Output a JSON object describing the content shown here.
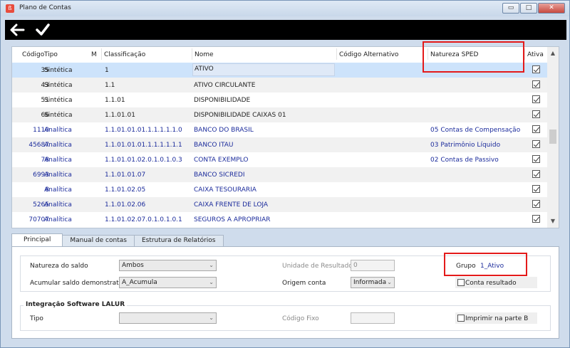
{
  "window": {
    "title": "Plano de Contas",
    "buttons": {
      "minimize": "▭",
      "maximize": "□",
      "close": "✕"
    }
  },
  "toolbar": {
    "back_icon": "arrow-left-icon",
    "confirm_icon": "check-icon"
  },
  "grid": {
    "columns": {
      "codigo": "Código",
      "tipo": "Tipo",
      "m": "M",
      "classificacao": "Classificação",
      "nome": "Nome",
      "codigo_alt": "Código Alternativo",
      "natureza_sped": "Natureza SPED",
      "ativa": "Ativa"
    },
    "rows": [
      {
        "codigo": "35",
        "tipo": "Sintética",
        "classificacao": "1",
        "nome": "ATIVO",
        "sped": "",
        "ativa": true,
        "analytic": false
      },
      {
        "codigo": "43",
        "tipo": "Sintética",
        "classificacao": "1.1",
        "nome": "ATIVO CIRCULANTE",
        "sped": "",
        "ativa": true,
        "analytic": false
      },
      {
        "codigo": "51",
        "tipo": "Sintética",
        "classificacao": "1.1.01",
        "nome": "DISPONIBILIDADE",
        "sped": "",
        "ativa": true,
        "analytic": false
      },
      {
        "codigo": "66",
        "tipo": "Sintética",
        "classificacao": "1.1.01.01",
        "nome": "DISPONIBILIDADE CAIXAS 01",
        "sped": "",
        "ativa": true,
        "analytic": false
      },
      {
        "codigo": "1110",
        "tipo": "Analítica",
        "classificacao": "1.1.01.01.01.1.1.1.1.1.0",
        "nome": "BANCO DO BRASIL",
        "sped": "05 Contas de Compensação",
        "ativa": true,
        "analytic": true
      },
      {
        "codigo": "45687",
        "tipo": "Analítica",
        "classificacao": "1.1.01.01.01.1.1.1.1.1.1",
        "nome": "BANCO ITAU",
        "sped": "03 Patrimônio Líquido",
        "ativa": true,
        "analytic": true
      },
      {
        "codigo": "78",
        "tipo": "Analítica",
        "classificacao": "1.1.01.01.02.0.1.0.1.0.3",
        "nome": "CONTA EXEMPLO",
        "sped": "02 Contas de Passivo",
        "ativa": true,
        "analytic": true
      },
      {
        "codigo": "6993",
        "tipo": "Analítica",
        "classificacao": "1.1.01.01.07",
        "nome": "BANCO SICREDI",
        "sped": "",
        "ativa": true,
        "analytic": true
      },
      {
        "codigo": "8",
        "tipo": "Analítica",
        "classificacao": "1.1.01.02.05",
        "nome": "CAIXA TESOURARIA",
        "sped": "",
        "ativa": true,
        "analytic": true
      },
      {
        "codigo": "5265",
        "tipo": "Analítica",
        "classificacao": "1.1.01.02.06",
        "nome": "CAIXA FRENTE DE LOJA",
        "sped": "",
        "ativa": true,
        "analytic": true
      },
      {
        "codigo": "70707",
        "tipo": "Analítica",
        "classificacao": "1.1.01.02.07.0.1.0.1.0.1",
        "nome": "SEGUROS A APROPRIAR",
        "sped": "",
        "ativa": true,
        "analytic": true
      }
    ]
  },
  "tabs": [
    "Principal",
    "Manual de contas",
    "Estrutura de Relatórios"
  ],
  "form": {
    "natureza_saldo_label": "Natureza do saldo",
    "natureza_saldo_value": "Ambos",
    "acumular_label": "Acumular saldo demonstrativo",
    "acumular_value": "A_Acumula",
    "unidade_label": "Unidade de Resultado",
    "unidade_value": "0",
    "origem_label": "Origem conta",
    "origem_value": "Informada",
    "grupo_label": "Grupo",
    "grupo_value": "1_Ativo",
    "conta_resultado_label": "Conta resultado",
    "lalur_title": "Integração Software LALUR",
    "tipo_label": "Tipo",
    "tipo_value": "",
    "codigo_fixo_label": "Código Fixo",
    "codigo_fixo_value": "",
    "imprimir_label": "Imprimir na parte B"
  }
}
